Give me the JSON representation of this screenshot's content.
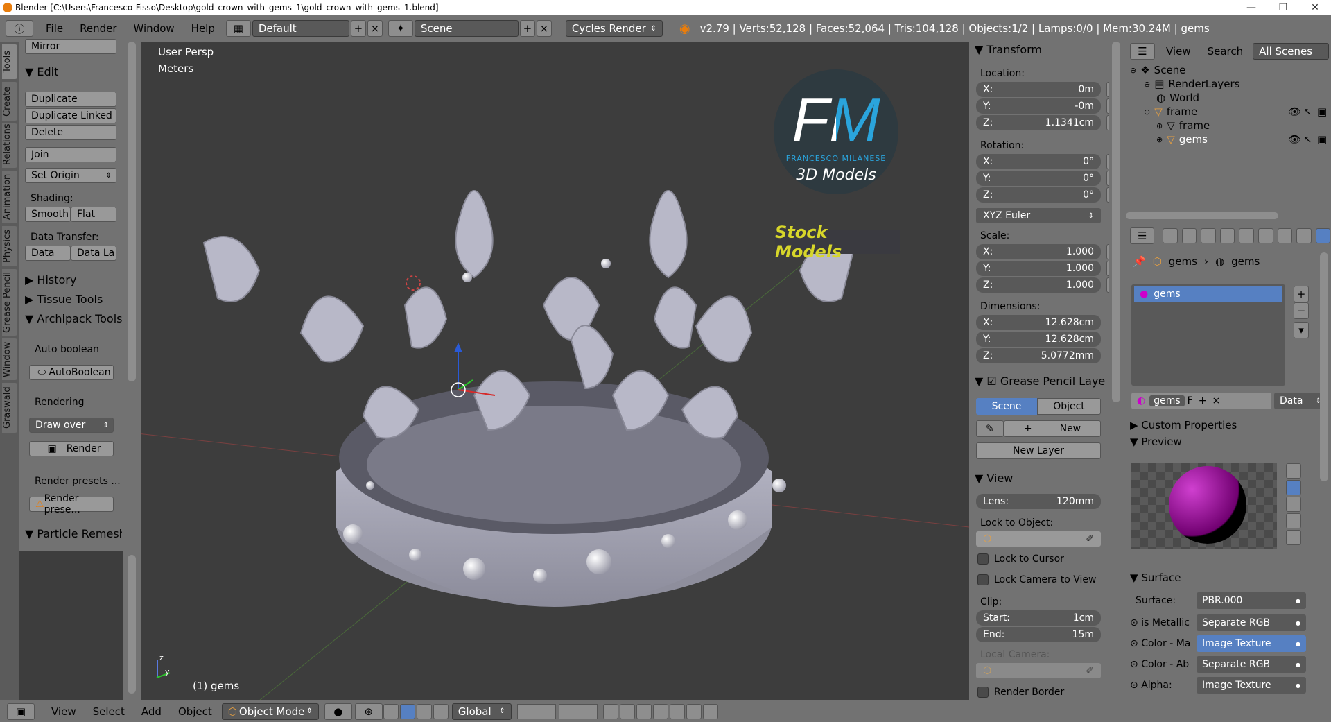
{
  "window": {
    "title": "Blender [C:\\Users\\Francesco-Fisso\\Desktop\\gold_crown_with_gems_1\\gold_crown_with_gems_1.blend]",
    "minimize": "—",
    "maximize": "❐",
    "close": "✕"
  },
  "header": {
    "menus": [
      "File",
      "Render",
      "Window",
      "Help"
    ],
    "layout": "Default",
    "scene": "Scene",
    "engine": "Cycles Render",
    "stats": "v2.79 | Verts:52,128 | Faces:52,064 | Tris:104,128 | Objects:1/2 | Lamps:0/0 | Mem:30.24M | gems"
  },
  "tabs": [
    "Tools",
    "Create",
    "Relations",
    "Animation",
    "Physics",
    "Grease Pencil",
    "Window",
    "Graswald"
  ],
  "toolshelf": {
    "mirror": "Mirror",
    "edit_head": "Edit",
    "duplicate": "Duplicate",
    "duplicate_linked": "Duplicate Linked",
    "delete": "Delete",
    "join": "Join",
    "set_origin": "Set Origin",
    "shading_label": "Shading:",
    "smooth": "Smooth",
    "flat": "Flat",
    "data_transfer_label": "Data Transfer:",
    "data": "Data",
    "data_la": "Data La",
    "history": "History",
    "tissue": "Tissue Tools",
    "archipack": "Archipack Tools",
    "auto_boolean_label": "Auto boolean",
    "autoboolean": "AutoBoolean",
    "rendering_label": "Rendering",
    "draw_over": "Draw over",
    "render": "Render",
    "render_presets_label": "Render presets ...",
    "render_presets_btn": "Render prese...",
    "particle": "Particle Remesh"
  },
  "viewport": {
    "view_name": "User Persp",
    "units": "Meters",
    "object_label": "(1) gems",
    "logo_fm": "FM",
    "logo_name": "FRANCESCO MILANESE",
    "logo_sub": "3D Models",
    "stock": "Stock Models",
    "axis_z": "z",
    "axis_y": "y"
  },
  "npanel": {
    "transform": "Transform",
    "location": "Location:",
    "loc": [
      {
        "l": "X:",
        "v": "0m"
      },
      {
        "l": "Y:",
        "v": "-0m"
      },
      {
        "l": "Z:",
        "v": "1.1341cm"
      }
    ],
    "rotation": "Rotation:",
    "rot": [
      {
        "l": "X:",
        "v": "0°"
      },
      {
        "l": "Y:",
        "v": "0°"
      },
      {
        "l": "Z:",
        "v": "0°"
      }
    ],
    "euler": "XYZ Euler",
    "scale": "Scale:",
    "scl": [
      {
        "l": "X:",
        "v": "1.000"
      },
      {
        "l": "Y:",
        "v": "1.000"
      },
      {
        "l": "Z:",
        "v": "1.000"
      }
    ],
    "dimensions": "Dimensions:",
    "dim": [
      {
        "l": "X:",
        "v": "12.628cm"
      },
      {
        "l": "Y:",
        "v": "12.628cm"
      },
      {
        "l": "Z:",
        "v": "5.0772mm"
      }
    ],
    "grease": "Grease Pencil Layer",
    "scene_btn": "Scene",
    "object_btn": "Object",
    "new": "New",
    "new_layer": "New Layer",
    "view": "View",
    "lens_l": "Lens:",
    "lens_v": "120mm",
    "lock_obj": "Lock to Object:",
    "lock_cursor": "Lock to Cursor",
    "lock_camera": "Lock Camera to View",
    "clip": "Clip:",
    "start_l": "Start:",
    "start_v": "1cm",
    "end_l": "End:",
    "end_v": "15m",
    "local_camera": "Local Camera:",
    "render_border": "Render Border"
  },
  "outliner": {
    "view": "View",
    "search": "Search",
    "all_scenes": "All Scenes",
    "items": [
      "Scene",
      "RenderLayers",
      "World",
      "frame",
      "frame",
      "gems"
    ]
  },
  "props": {
    "crumb1": "gems",
    "crumb2": "gems",
    "slot": "gems",
    "mat_name": "gems",
    "mat_f": "F",
    "data": "Data",
    "custom": "Custom Properties",
    "preview": "Preview",
    "surface_head": "Surface",
    "surface_l": "Surface:",
    "surface_v": "PBR.000",
    "rows": [
      {
        "l": "is Metallic",
        "v": "Separate RGB"
      },
      {
        "l": "Color - Ma",
        "v": "Image Texture"
      },
      {
        "l": "Color - Ab",
        "v": "Separate RGB"
      },
      {
        "l": "Alpha:",
        "v": "Image Texture"
      }
    ]
  },
  "bottom": {
    "view": "View",
    "select": "Select",
    "add": "Add",
    "object": "Object",
    "mode": "Object Mode",
    "orient": "Global"
  },
  "colors": {
    "accent": "#5680c2",
    "logo_blue": "#2aa4dc",
    "stock_yellow": "#d7d62a"
  }
}
